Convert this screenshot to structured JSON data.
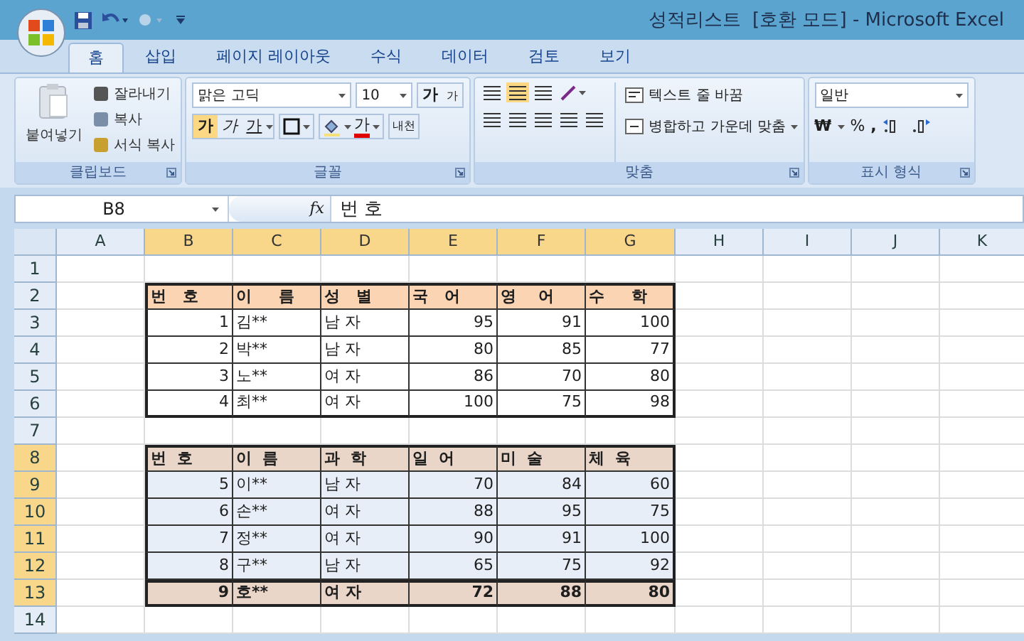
{
  "window": {
    "title": "성적리스트  [호환 모드] - Microsoft Excel"
  },
  "tabs": [
    {
      "label": "홈",
      "selected": true
    },
    {
      "label": "삽입",
      "selected": false
    },
    {
      "label": "페이지 레이아웃",
      "selected": false
    },
    {
      "label": "수식",
      "selected": false
    },
    {
      "label": "데이터",
      "selected": false
    },
    {
      "label": "검토",
      "selected": false
    },
    {
      "label": "보기",
      "selected": false
    }
  ],
  "ribbon": {
    "clipboard": {
      "label": "클립보드",
      "paste": "붙여넣기",
      "cut": "잘라내기",
      "copy": "복사",
      "format_painter": "서식 복사"
    },
    "font": {
      "label": "글꼴",
      "font_name": "맑은 고딕",
      "font_size": "10",
      "grow": "가",
      "shrink": "가",
      "bold": "가",
      "italic": "가",
      "underline": "가",
      "font_color": "가",
      "phonetic": "내천"
    },
    "alignment": {
      "label": "맞춤",
      "wrap_text": "텍스트 줄 바꿈",
      "merge_center": "병합하고 가운데 맞춤"
    },
    "number": {
      "label": "표시 형식",
      "format": "일반",
      "currency": "₩",
      "percent": "%",
      "comma": ","
    }
  },
  "name_box": "B8",
  "function_button": "fx",
  "formula": "번 호",
  "columns": [
    {
      "label": "A",
      "selected": false
    },
    {
      "label": "B",
      "selected": true
    },
    {
      "label": "C",
      "selected": true
    },
    {
      "label": "D",
      "selected": true
    },
    {
      "label": "E",
      "selected": true
    },
    {
      "label": "F",
      "selected": true
    },
    {
      "label": "G",
      "selected": true
    },
    {
      "label": "H",
      "selected": false
    },
    {
      "label": "I",
      "selected": false
    },
    {
      "label": "J",
      "selected": false
    },
    {
      "label": "K",
      "selected": false
    }
  ],
  "rows": [
    {
      "label": "1",
      "selected": false
    },
    {
      "label": "2",
      "selected": false,
      "kind": "header",
      "cells": [
        "번   호",
        "이     름",
        "성   별",
        "국   어",
        "영    어",
        "수     학"
      ]
    },
    {
      "label": "3",
      "selected": false,
      "kind": "plain",
      "cells": [
        "1",
        "김**",
        "남 자",
        "95",
        "91",
        "100"
      ]
    },
    {
      "label": "4",
      "selected": false,
      "kind": "plain",
      "cells": [
        "2",
        "박**",
        "남 자",
        "80",
        "85",
        "77"
      ]
    },
    {
      "label": "5",
      "selected": false,
      "kind": "plain",
      "cells": [
        "3",
        "노**",
        "여 자",
        "86",
        "70",
        "80"
      ]
    },
    {
      "label": "6",
      "selected": false,
      "kind": "plain",
      "cells": [
        "4",
        "최**",
        "여 자",
        "100",
        "75",
        "98"
      ]
    },
    {
      "label": "7",
      "selected": false
    },
    {
      "label": "8",
      "selected": true,
      "kind": "header2",
      "cells": [
        "번  호",
        "이  름",
        "과  학",
        "일  어",
        "미  술",
        "체  육"
      ]
    },
    {
      "label": "9",
      "selected": true,
      "kind": "banded",
      "cells": [
        "5",
        "이**",
        "남 자",
        "70",
        "84",
        "60"
      ]
    },
    {
      "label": "10",
      "selected": true,
      "kind": "banded",
      "cells": [
        "6",
        "손**",
        "여 자",
        "88",
        "95",
        "75"
      ]
    },
    {
      "label": "11",
      "selected": true,
      "kind": "banded",
      "cells": [
        "7",
        "정**",
        "여 자",
        "90",
        "91",
        "100"
      ]
    },
    {
      "label": "12",
      "selected": true,
      "kind": "banded",
      "cells": [
        "8",
        "구**",
        "남 자",
        "65",
        "75",
        "92"
      ]
    },
    {
      "label": "13",
      "selected": true,
      "kind": "total",
      "cells": [
        "9",
        "호**",
        "여 자",
        "72",
        "88",
        "80"
      ]
    },
    {
      "label": "14",
      "selected": false
    }
  ]
}
